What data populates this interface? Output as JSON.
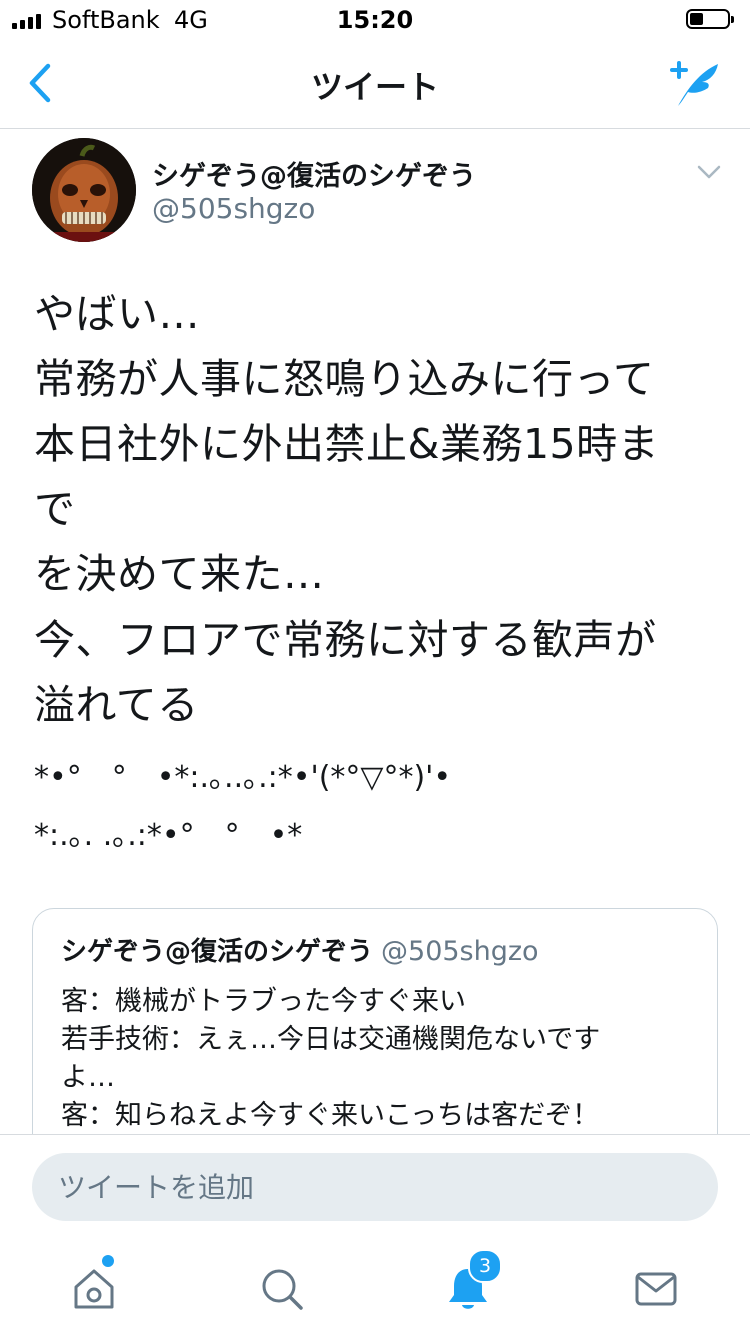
{
  "status_bar": {
    "carrier": "SoftBank",
    "network": "4G",
    "time": "15:20",
    "battery_level": 0.35
  },
  "nav": {
    "title": "ツイート",
    "back_icon": "chevron-left-icon",
    "compose_icon": "compose-tweet-icon"
  },
  "accent_color": "#1da1f2",
  "tweet": {
    "author_name": "シゲぞう@復活のシゲぞう",
    "author_handle": "@505shgzo",
    "text_lines": [
      "やばい…",
      "常務が人事に怒鳴り込みに行って",
      "本日社外に外出禁止&業務15時ま",
      "で",
      "を決めて来た…"
    ],
    "text_lines_2": [
      "今、フロアで常務に対する歓声が",
      "溢れてる"
    ],
    "kaomoji_lines": [
      "*•°　°　•*:.｡..｡.:*•'(*°▽°*)'•",
      "*:.｡. .｡.:*•°　°　•*"
    ]
  },
  "quoted_tweet": {
    "author_name": "シゲぞう@復活のシゲぞう",
    "author_handle": "@505shgzo",
    "lines": [
      "客：機械がトラブった今すぐ来い",
      "若手技術：えぇ…今日は交通機関危ないです",
      "よ…",
      "客：知らねえよ今すぐ来いこっちは客だぞ！"
    ]
  },
  "reply": {
    "placeholder": "ツイートを追加"
  },
  "tab_bar": {
    "tabs": [
      {
        "name": "home",
        "icon": "home-icon"
      },
      {
        "name": "search",
        "icon": "search-icon"
      },
      {
        "name": "notifications",
        "icon": "bell-icon",
        "badge": "3"
      },
      {
        "name": "messages",
        "icon": "envelope-icon"
      }
    ]
  }
}
